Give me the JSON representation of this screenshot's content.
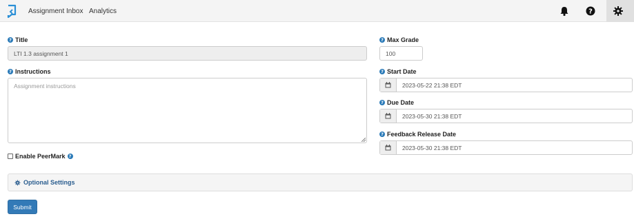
{
  "nav": {
    "links": [
      "Assignment Inbox",
      "Analytics"
    ],
    "icons": [
      "logo-icon",
      "bell-icon",
      "help-icon",
      "gear-icon"
    ]
  },
  "form": {
    "title_label": "Title",
    "title_value": "LTI 1.3 assignment 1",
    "instructions_label": "Instructions",
    "instructions_placeholder": "Assignment instructions",
    "peermark_label": "Enable PeerMark",
    "max_grade_label": "Max Grade",
    "max_grade_value": "100",
    "start_date_label": "Start Date",
    "start_date_value": "2023-05-22 21:38 EDT",
    "due_date_label": "Due Date",
    "due_date_value": "2023-05-30 21:38 EDT",
    "feedback_date_label": "Feedback Release Date",
    "feedback_date_value": "2023-05-30 21:38 EDT",
    "optional_settings_label": "Optional Settings",
    "submit_label": "Submit"
  },
  "colors": {
    "accent": "#337ab7",
    "help_icon": "#2a7ab8",
    "topbar": "#f4f4f4"
  }
}
